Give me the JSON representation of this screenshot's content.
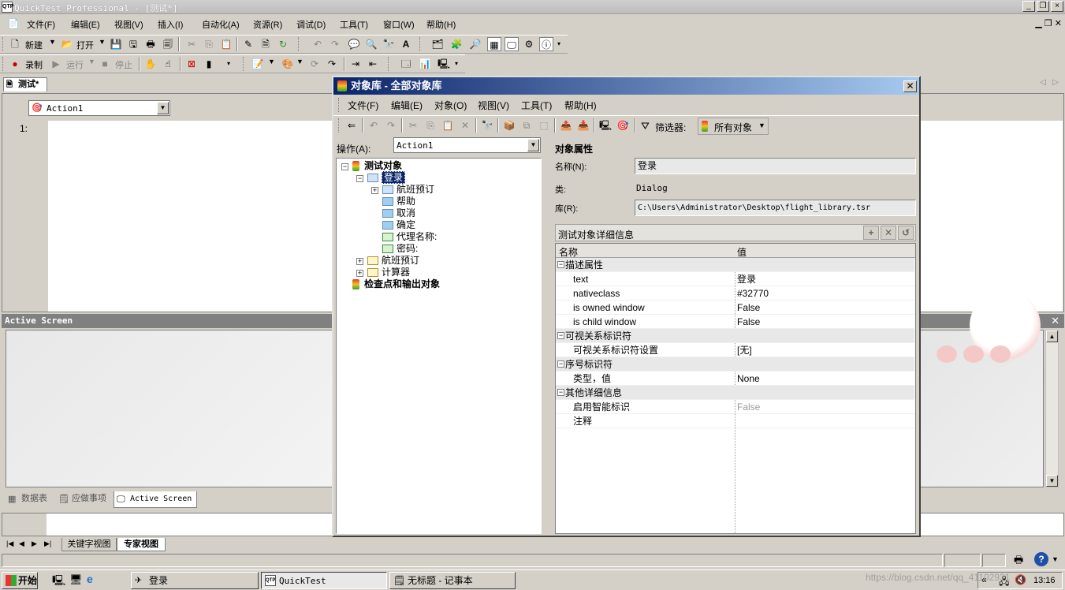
{
  "window": {
    "title": "QuickTest Professional - [测试*]",
    "app_icon": "QTP"
  },
  "menubar": [
    "文件(F)",
    "编辑(E)",
    "视图(V)",
    "插入(I)",
    "自动化(A)",
    "资源(R)",
    "调试(D)",
    "工具(T)",
    "窗口(W)",
    "帮助(H)"
  ],
  "toolbar1": {
    "new_label": "新建",
    "open_label": "打开"
  },
  "toolbar2": {
    "record_label": "录制",
    "run_label": "运行",
    "stop_label": "停止"
  },
  "doc": {
    "tab_label": "测试*",
    "action_combo": "Action1",
    "line_number": "1:",
    "active_screen_title": "Active Screen",
    "bottom_tabs": [
      "数据表",
      "应做事项",
      "Active Screen"
    ],
    "view_tabs": [
      "关键字视图",
      "专家视图"
    ]
  },
  "dialog": {
    "title": "对象库 - 全部对象库",
    "menu": [
      "文件(F)",
      "编辑(E)",
      "对象(O)",
      "视图(V)",
      "工具(T)",
      "帮助(H)"
    ],
    "filter_label": "筛选器:",
    "filter_value": "所有对象",
    "action_label": "操作(A):",
    "action_value": "Action1",
    "tree": {
      "root": "测试对象",
      "selected": "登录",
      "children": [
        "航班预订",
        "帮助",
        "取消",
        "确定",
        "代理名称:",
        "密码:"
      ],
      "siblings": [
        "航班预订",
        "计算器"
      ],
      "checkpoints": "检查点和输出对象"
    },
    "props": {
      "section_title": "对象属性",
      "name_label": "名称(N):",
      "name_value": "登录",
      "class_label": "类:",
      "class_value": "Dialog",
      "lib_label": "库(R):",
      "lib_value": "C:\\Users\\Administrator\\Desktop\\flight_library.tsr",
      "details_title": "测试对象详细信息",
      "col_name": "名称",
      "col_value": "值",
      "rows": [
        {
          "type": "cat",
          "name": "描述属性",
          "value": ""
        },
        {
          "type": "row",
          "name": "text",
          "value": "登录"
        },
        {
          "type": "row",
          "name": "nativeclass",
          "value": "#32770"
        },
        {
          "type": "row",
          "name": "is owned window",
          "value": "False"
        },
        {
          "type": "row",
          "name": "is child window",
          "value": "False"
        },
        {
          "type": "cat",
          "name": "可视关系标识符",
          "value": ""
        },
        {
          "type": "row",
          "name": "可视关系标识符设置",
          "value": "[无]"
        },
        {
          "type": "cat",
          "name": "序号标识符",
          "value": ""
        },
        {
          "type": "row",
          "name": "类型，值",
          "value": "None"
        },
        {
          "type": "cat",
          "name": "其他详细信息",
          "value": ""
        },
        {
          "type": "row",
          "name": "启用智能标识",
          "value": "False"
        },
        {
          "type": "row",
          "name": "注释",
          "value": ""
        }
      ]
    }
  },
  "taskbar": {
    "start_label": "开始",
    "tasks": [
      "登录",
      "QuickTest Professio...",
      "无标题 - 记事本"
    ],
    "clock": "13:16",
    "watermark": "https://blog.csdn.net/qq_41102931"
  }
}
